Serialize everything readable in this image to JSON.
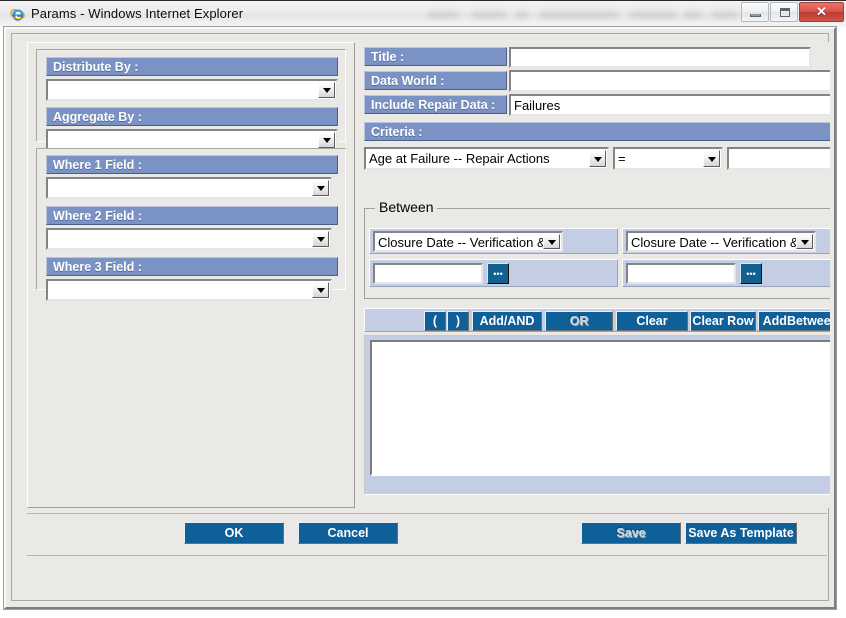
{
  "window": {
    "title": "Params - Windows Internet Explorer",
    "icon": "internet-explorer-icon",
    "minimize_label": "",
    "maximize_label": "",
    "close_label": "✕"
  },
  "left_panel": {
    "distribute_by": {
      "label": "Distribute By :",
      "value": ""
    },
    "aggregate_by": {
      "label": "Aggregate By :",
      "value": ""
    },
    "where1": {
      "label": "Where 1 Field :",
      "value": ""
    },
    "where2": {
      "label": "Where 2 Field :",
      "value": ""
    },
    "where3": {
      "label": "Where 3 Field :",
      "value": ""
    }
  },
  "right_panel": {
    "title_field": {
      "label": "Title :",
      "value": ""
    },
    "data_world": {
      "label": "Data World :",
      "value": ""
    },
    "include_repair_data": {
      "label": "Include Repair Data :",
      "value": "Failures"
    },
    "criteria_header": "Criteria :",
    "criteria_row": {
      "field": "Age at Failure -- Repair Actions",
      "operator": "=",
      "value": "",
      "browse_label": "…"
    },
    "between": {
      "legend": "Between",
      "left_field": "Closure Date -- Verification & C",
      "right_field": "Closure Date -- Verification & C",
      "left_value": "",
      "right_value": "",
      "left_browse": "…",
      "right_browse": "…"
    },
    "operator_buttons": [
      {
        "label": "(",
        "state": "normal"
      },
      {
        "label": ")",
        "state": "normal"
      },
      {
        "label": "Add/AND",
        "state": "normal"
      },
      {
        "label": "OR",
        "state": "pressed"
      },
      {
        "label": "Clear",
        "state": "normal"
      },
      {
        "label": "Clear Row",
        "state": "normal"
      },
      {
        "label": "AddBetween",
        "state": "normal"
      }
    ],
    "expression_box": {
      "value": ""
    }
  },
  "footer": {
    "ok": "OK",
    "cancel": "Cancel",
    "save": "Save",
    "save_as_template": "Save As Template"
  },
  "colors": {
    "label_blue": "#7b92c4",
    "button_blue": "#0f5f99",
    "panel_blue": "#c3cee5",
    "window_gray": "#eae9e5"
  }
}
